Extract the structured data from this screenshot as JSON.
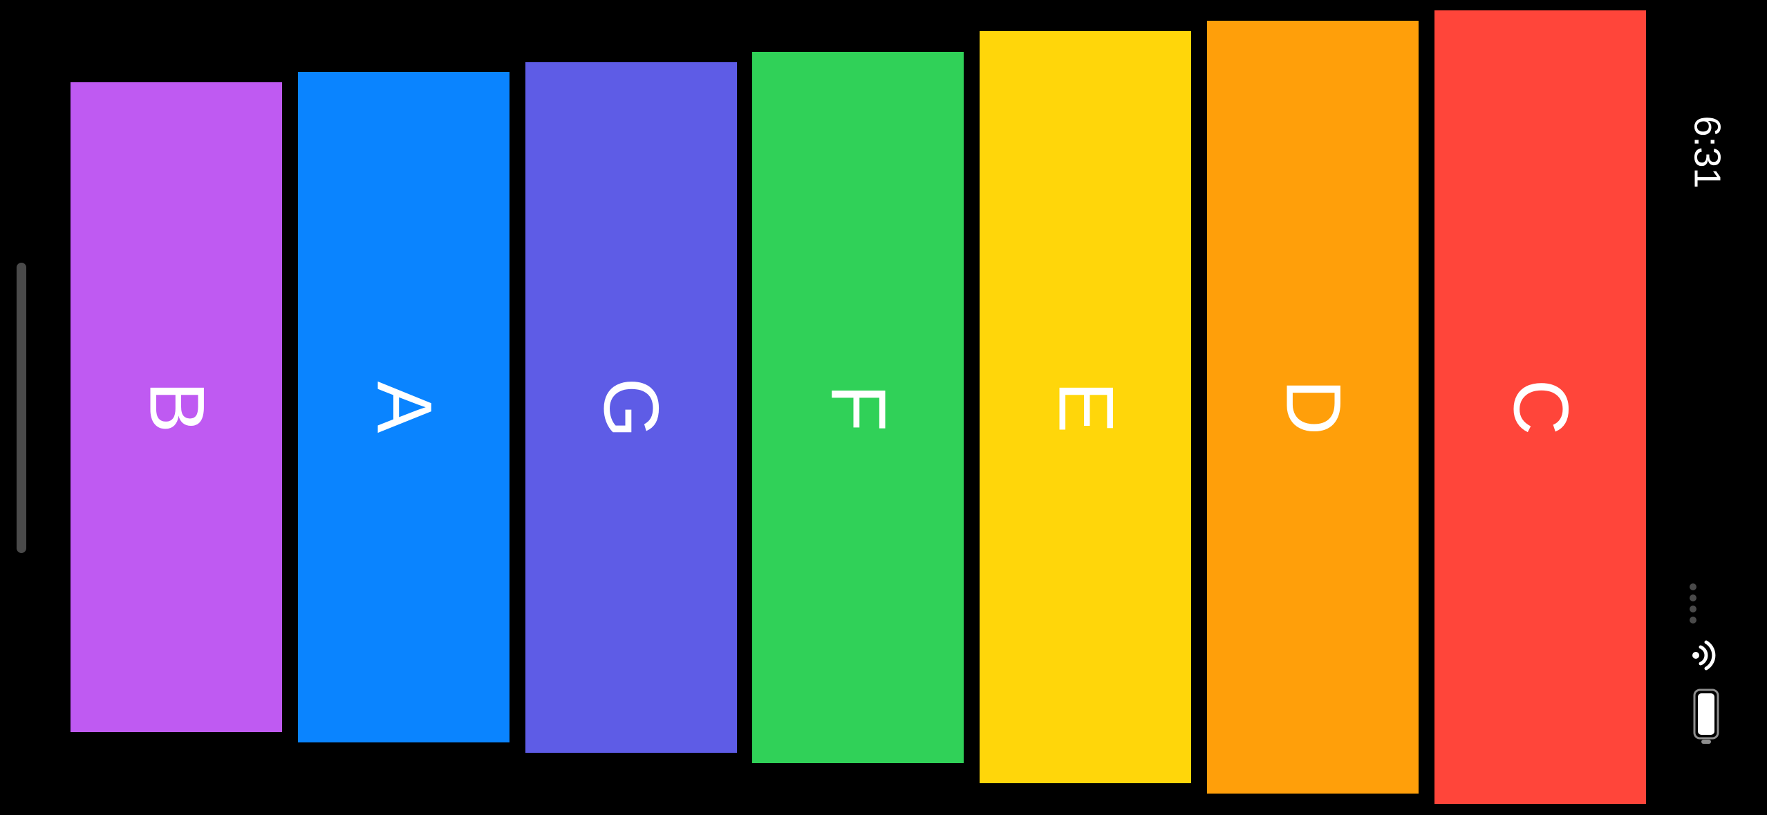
{
  "colors": {
    "background": "#000000",
    "label": "#ffffff",
    "B": "#bf5af2",
    "A": "#0a84ff",
    "G": "#5e5ce6",
    "F": "#30d158",
    "E": "#ffd60a",
    "D": "#ff9f0a",
    "C": "#ff453a"
  },
  "keys": [
    {
      "label": "B",
      "color": "#bf5af2"
    },
    {
      "label": "A",
      "color": "#0a84ff"
    },
    {
      "label": "G",
      "color": "#5e5ce6"
    },
    {
      "label": "F",
      "color": "#30d158"
    },
    {
      "label": "E",
      "color": "#ffd60a"
    },
    {
      "label": "D",
      "color": "#ff9f0a"
    },
    {
      "label": "C",
      "color": "#ff453a"
    }
  ],
  "status_bar": {
    "time": "6:31",
    "icons": [
      "cellular-signal-icon",
      "wifi-icon",
      "battery-icon"
    ]
  }
}
